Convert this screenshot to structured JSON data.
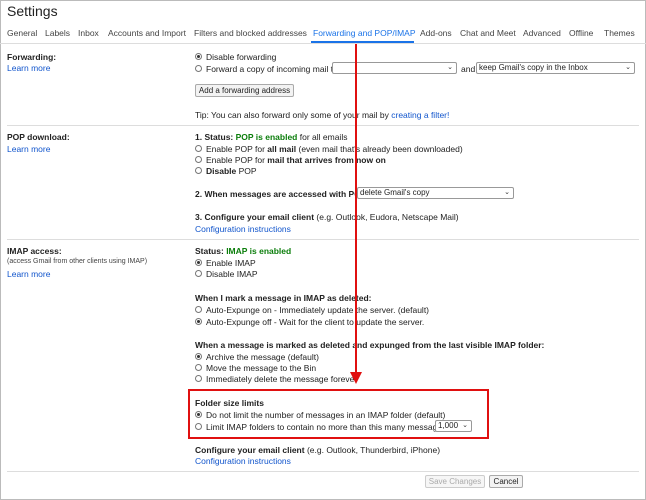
{
  "title": "Settings",
  "tabs": [
    {
      "label": "General"
    },
    {
      "label": "Labels"
    },
    {
      "label": "Inbox"
    },
    {
      "label": "Accounts and Import"
    },
    {
      "label": "Filters and blocked addresses"
    },
    {
      "label": "Forwarding and POP/IMAP"
    },
    {
      "label": "Add-ons"
    },
    {
      "label": "Chat and Meet"
    },
    {
      "label": "Advanced"
    },
    {
      "label": "Offline"
    },
    {
      "label": "Themes"
    }
  ],
  "active_tab": "Forwarding and POP/IMAP",
  "forwarding": {
    "label": "Forwarding:",
    "learn_more": "Learn more",
    "opt_disable": "Disable forwarding",
    "opt_forward": "Forward a copy of incoming mail to",
    "and": "and",
    "keep_select": "keep Gmail's copy in the Inbox",
    "add_button": "Add a forwarding address",
    "tip_prefix": "Tip: You can also forward only some of your mail by",
    "tip_link": "creating a filter!"
  },
  "pop": {
    "label": "POP download:",
    "learn_more": "Learn more",
    "status_prefix": "1. Status:",
    "status_value": "POP is enabled",
    "status_suffix": "for all emails",
    "opt1_prefix": "Enable POP for",
    "opt1_bold": "all mail",
    "opt1_suffix": "(even mail that's already been downloaded)",
    "opt2_prefix": "Enable POP for",
    "opt2_bold": "mail that arrives from now on",
    "opt3_bold": "Disable",
    "opt3_suffix": "POP",
    "when_accessed": "2. When messages are accessed with POP",
    "when_select": "delete Gmail's copy",
    "configure": "3. Configure your email client",
    "configure_suffix": "(e.g. Outlook, Eudora, Netscape Mail)",
    "config_link": "Configuration instructions"
  },
  "imap": {
    "label": "IMAP access:",
    "sub": "(access Gmail from other clients using IMAP)",
    "learn_more": "Learn more",
    "status_prefix": "Status:",
    "status_value": "IMAP is enabled",
    "enable": "Enable IMAP",
    "disable": "Disable IMAP",
    "deleted_heading": "When I mark a message in IMAP as deleted:",
    "expunge_on": "Auto-Expunge on - Immediately update the server. (default)",
    "expunge_off": "Auto-Expunge off - Wait for the client to update the server.",
    "expunged_heading": "When a message is marked as deleted and expunged from the last visible IMAP folder:",
    "archive": "Archive the message (default)",
    "bin": "Move the message to the Bin",
    "delete_forever": "Immediately delete the message forever",
    "folder_heading": "Folder size limits",
    "no_limit": "Do not limit the number of messages in an IMAP folder (default)",
    "limit": "Limit IMAP folders to contain no more than this many messages",
    "limit_select": "1,000",
    "configure": "Configure your email client",
    "configure_suffix": "(e.g. Outlook, Thunderbird, iPhone)",
    "config_link": "Configuration instructions"
  },
  "footer": {
    "save": "Save Changes",
    "cancel": "Cancel"
  },
  "colors": {
    "accent": "#1a73e8",
    "link": "#1155cc",
    "enabled_green": "#0a7d0a",
    "annotation_red": "#e01010"
  }
}
